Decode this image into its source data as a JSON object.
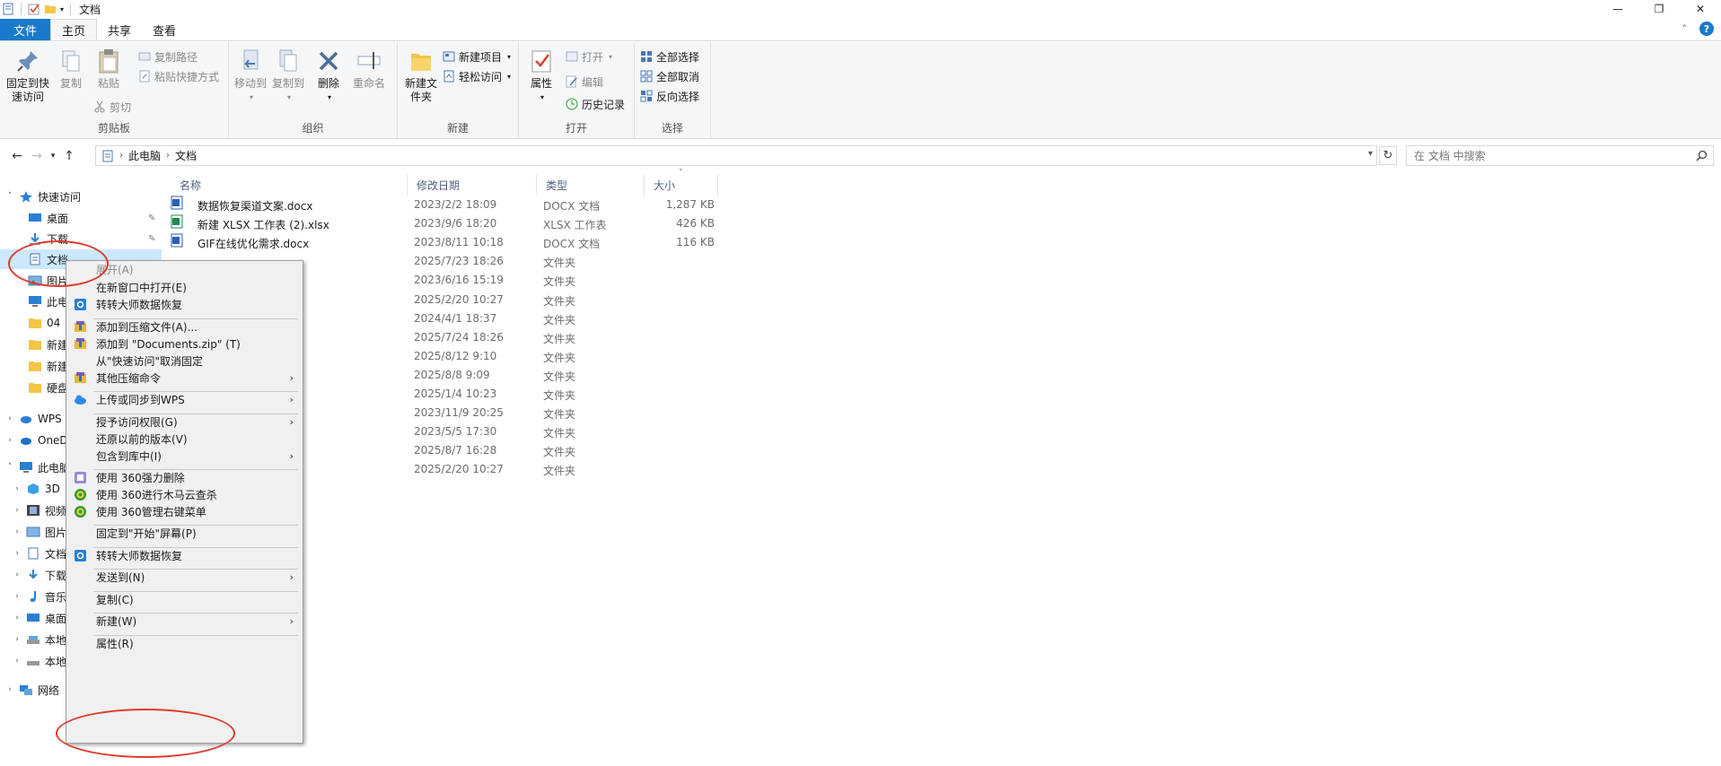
{
  "titlebar": {
    "title": "文档",
    "buttons": {
      "minimize": "—",
      "maximize": "❐",
      "close": "✕"
    }
  },
  "tabs": [
    {
      "label": "文件"
    },
    {
      "label": "主页"
    },
    {
      "label": "共享"
    },
    {
      "label": "查看"
    }
  ],
  "ribbon": {
    "clipboard": {
      "label": "剪贴板",
      "pin_quick": "固定到快速访问",
      "copy": "复制",
      "paste": "粘贴",
      "copy_path": "复制路径",
      "paste_shortcut": "粘贴快捷方式",
      "cut": "剪切"
    },
    "organize": {
      "label": "组织",
      "move_to": "移动到",
      "copy_to": "复制到",
      "delete": "删除",
      "rename": "重命名"
    },
    "new": {
      "label": "新建",
      "new_folder": "新建文件夹",
      "new_item": "新建项目",
      "easy_access": "轻松访问"
    },
    "open": {
      "label": "打开",
      "properties": "属性",
      "open": "打开",
      "edit": "编辑",
      "history": "历史记录"
    },
    "select": {
      "label": "选择",
      "select_all": "全部选择",
      "select_none": "全部取消",
      "invert": "反向选择"
    }
  },
  "address": {
    "crumbs": [
      "此电脑",
      "文档"
    ],
    "search_placeholder": "在 文档 中搜索"
  },
  "navpane": {
    "quick_access": "快速访问",
    "items": [
      {
        "label": "桌面"
      },
      {
        "label": "下载"
      },
      {
        "label": "文档"
      },
      {
        "label": "图片"
      },
      {
        "label": "此电"
      },
      {
        "label": "04"
      },
      {
        "label": "新建"
      },
      {
        "label": "新建"
      },
      {
        "label": "硬盘"
      }
    ],
    "wps": "WPS",
    "onedrive": "OneD",
    "this_pc": "此电脑",
    "pc_items": [
      {
        "label": "3D"
      },
      {
        "label": "视频"
      },
      {
        "label": "图片"
      },
      {
        "label": "文档"
      },
      {
        "label": "下载"
      },
      {
        "label": "音乐"
      },
      {
        "label": "桌面"
      },
      {
        "label": "本地"
      },
      {
        "label": "本地"
      }
    ],
    "network": "网络"
  },
  "filelist": {
    "headers": {
      "name": "名称",
      "date": "修改日期",
      "type": "类型",
      "size": "大小"
    },
    "rows": [
      {
        "name": "数据恢复渠道文案.docx",
        "date": "2023/2/2 18:09",
        "type": "DOCX 文档",
        "size": "1,287 KB",
        "icon": "word-icon"
      },
      {
        "name": "新建 XLSX 工作表 (2).xlsx",
        "date": "2023/9/6 18:20",
        "type": "XLSX 工作表",
        "size": "426 KB",
        "icon": "excel-icon"
      },
      {
        "name": "GIF在线优化需求.docx",
        "date": "2023/8/11 10:18",
        "type": "DOCX 文档",
        "size": "116 KB",
        "icon": "word-icon"
      },
      {
        "name": "",
        "date": "2025/7/23 18:26",
        "type": "文件夹",
        "size": ""
      },
      {
        "name": "",
        "date": "2023/6/16 15:19",
        "type": "文件夹",
        "size": ""
      },
      {
        "name": "",
        "date": "2025/2/20 10:27",
        "type": "文件夹",
        "size": ""
      },
      {
        "name": "",
        "date": "2024/4/1 18:37",
        "type": "文件夹",
        "size": ""
      },
      {
        "name": "",
        "date": "2025/7/24 18:26",
        "type": "文件夹",
        "size": ""
      },
      {
        "name": "",
        "date": "2025/8/12 9:10",
        "type": "文件夹",
        "size": ""
      },
      {
        "name": "",
        "date": "2025/8/8 9:09",
        "type": "文件夹",
        "size": ""
      },
      {
        "name": "",
        "date": "2025/1/4 10:23",
        "type": "文件夹",
        "size": ""
      },
      {
        "name": "",
        "date": "2023/11/9 20:25",
        "type": "文件夹",
        "size": ""
      },
      {
        "name": "",
        "date": "2023/5/5 17:30",
        "type": "文件夹",
        "size": ""
      },
      {
        "name": "",
        "date": "2025/8/7 16:28",
        "type": "文件夹",
        "size": ""
      },
      {
        "name": "",
        "date": "2025/2/20 10:27",
        "type": "文件夹",
        "size": ""
      }
    ]
  },
  "context_menu": {
    "items": [
      {
        "label": "展开(A)",
        "disabled": true
      },
      {
        "label": "在新窗口中打开(E)"
      },
      {
        "label": "转转大师数据恢复",
        "icon": "recovery-app-icon"
      },
      {
        "label": "添加到压缩文件(A)...",
        "icon": "archive-icon"
      },
      {
        "label": "添加到 \"Documents.zip\" (T)",
        "icon": "archive-icon"
      },
      {
        "label": "从\"快速访问\"取消固定"
      },
      {
        "label": "其他压缩命令",
        "icon": "archive-icon",
        "submenu": true
      },
      {
        "label": "上传或同步到WPS",
        "icon": "cloud-icon",
        "submenu": true
      },
      {
        "label": "授予访问权限(G)",
        "submenu": true
      },
      {
        "label": "还原以前的版本(V)"
      },
      {
        "label": "包含到库中(I)",
        "submenu": true
      },
      {
        "label": "使用 360强力删除",
        "icon": "shred-icon"
      },
      {
        "label": "使用 360进行木马云查杀",
        "icon": "360-icon"
      },
      {
        "label": "使用 360管理右键菜单",
        "icon": "360-icon"
      },
      {
        "label": "固定到\"开始\"屏幕(P)"
      },
      {
        "label": "转转大师数据恢复",
        "icon": "recovery-app-icon"
      },
      {
        "label": "发送到(N)",
        "submenu": true
      },
      {
        "label": "复制(C)"
      },
      {
        "label": "新建(W)",
        "submenu": true
      },
      {
        "label": "属性(R)"
      }
    ],
    "submenu_glyph": "›"
  },
  "colors": {
    "accent": "#1979ca",
    "selection": "#cce8ff",
    "annotation": "#e03c2d"
  }
}
